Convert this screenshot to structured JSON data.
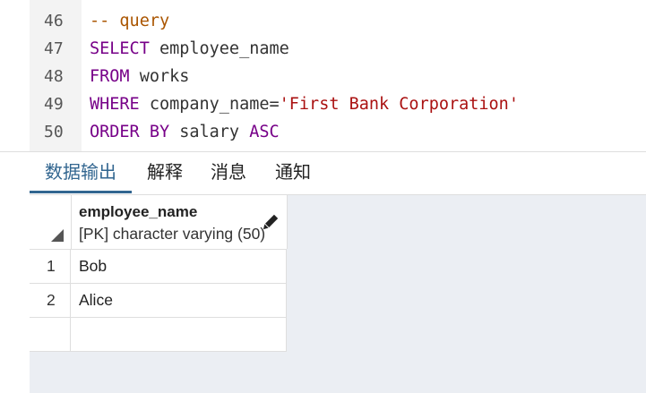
{
  "editor": {
    "lines": [
      {
        "num": "46",
        "comment": "-- query"
      },
      {
        "num": "47",
        "kw": "SELECT",
        "rest": " employee_name"
      },
      {
        "num": "48",
        "kw": "FROM",
        "rest": " works"
      },
      {
        "num": "49",
        "kw": "WHERE",
        "rest": " company_name=",
        "str": "'First Bank Corporation'"
      },
      {
        "num": "50",
        "kw": "ORDER BY",
        "rest": " salary ",
        "kw2": "ASC"
      }
    ]
  },
  "tabs": [
    {
      "label": "数据输出",
      "active": true
    },
    {
      "label": "解释",
      "active": false
    },
    {
      "label": "消息",
      "active": false
    },
    {
      "label": "通知",
      "active": false
    }
  ],
  "results": {
    "column": {
      "name": "employee_name",
      "type": "[PK] character varying (50)"
    },
    "rows": [
      {
        "num": "1",
        "value": "Bob"
      },
      {
        "num": "2",
        "value": "Alice"
      },
      {
        "num": "",
        "value": ""
      }
    ]
  },
  "colors": {
    "keyword": "#770088",
    "string": "#aa1111",
    "comment": "#aa5500",
    "active_tab": "#326690",
    "results_bg": "#ebeef3"
  },
  "icons": {
    "corner": "sort-triangle-icon",
    "column_edit": "pencil-icon"
  }
}
